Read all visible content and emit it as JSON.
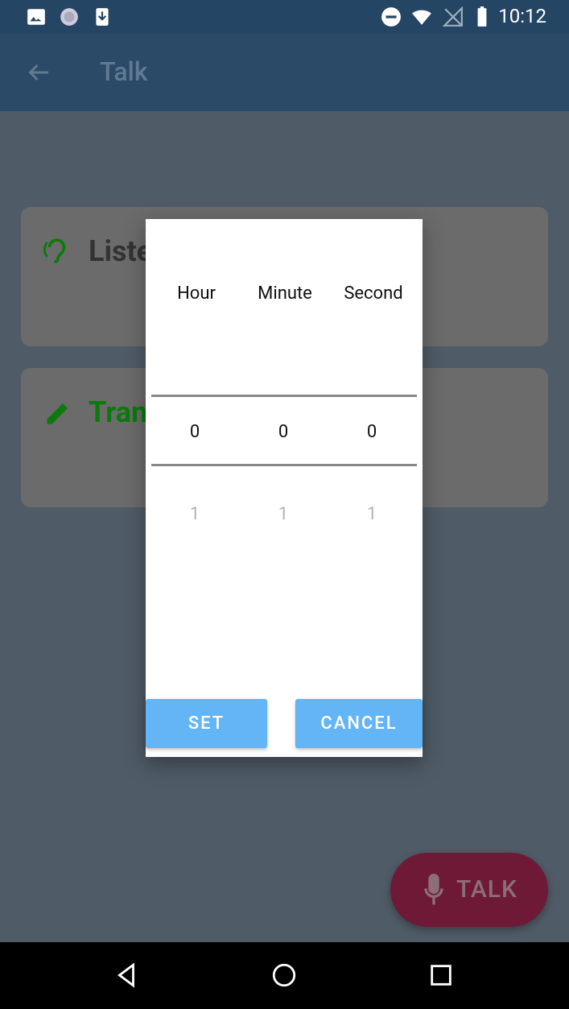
{
  "status_bar": {
    "time": "10:12",
    "icons_left": [
      "image-icon",
      "sync-icon",
      "download-icon"
    ],
    "icons_right": [
      "do-not-disturb-icon",
      "wifi-icon",
      "no-signal-icon",
      "battery-icon"
    ]
  },
  "app_bar": {
    "title": "Talk",
    "back_icon": "arrow-back-icon"
  },
  "cards": [
    {
      "title": "Liste",
      "icon": "hearing-icon",
      "color": "#0a7a0a"
    },
    {
      "title": "Tran",
      "icon": "edit-pencil-icon",
      "color": "#0a7a0a"
    }
  ],
  "fab": {
    "label": "TALK",
    "icon": "mic-icon"
  },
  "dialog": {
    "columns": [
      {
        "header": "Hour",
        "selected": "0",
        "next": "1"
      },
      {
        "header": "Minute",
        "selected": "0",
        "next": "1"
      },
      {
        "header": "Second",
        "selected": "0",
        "next": "1"
      }
    ],
    "set_label": "SET",
    "cancel_label": "CANCEL"
  },
  "nav_bar": {
    "buttons": [
      "back-triangle-icon",
      "home-circle-icon",
      "recents-square-icon"
    ]
  },
  "colors": {
    "button_blue": "#64b5f6",
    "card_title_green": "#0a7a0a"
  }
}
